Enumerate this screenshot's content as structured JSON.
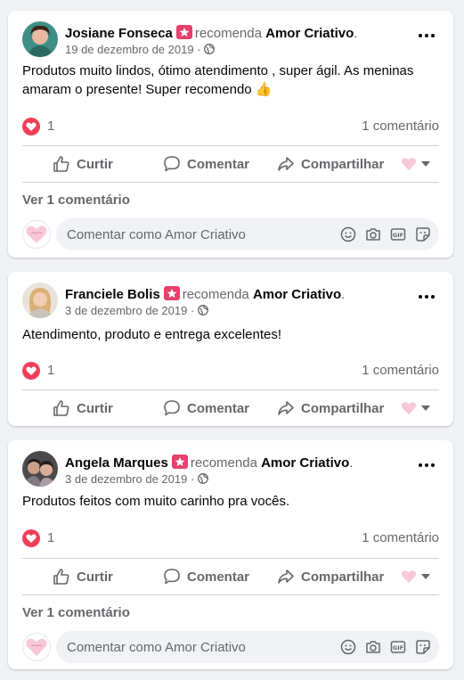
{
  "page_name": "Amor Criativo",
  "verb": "recomenda",
  "composer_placeholder": "Comentar como Amor Criativo",
  "actions": {
    "like": "Curtir",
    "comment": "Comentar",
    "share": "Compartilhar"
  },
  "colors": {
    "reaction_heart": "#f33e58",
    "recommend_badge": "#e5416c",
    "secondary_text": "#65676b"
  },
  "posts": [
    {
      "author": "Josiane Fonseca",
      "date": "19 de dezembro de 2019",
      "text": "Produtos muito lindos, ótimo atendimento , super ágil.  As meninas amaram o presente! Super recomendo 👍",
      "reaction_count": "1",
      "comment_count": "1 comentário",
      "view_comments": "Ver 1 comentário"
    },
    {
      "author": "Franciele Bolis",
      "date": "3 de dezembro de 2019",
      "text": "Atendimento, produto e entrega excelentes!",
      "reaction_count": "1",
      "comment_count": "1 comentário"
    },
    {
      "author": "Angela Marques",
      "date": "3 de dezembro de 2019",
      "text": "Produtos feitos com muito carinho pra vocês.",
      "reaction_count": "1",
      "comment_count": "1 comentário",
      "view_comments": "Ver 1 comentário"
    }
  ],
  "icons": [
    "recommend-badge-icon",
    "globe-icon",
    "more-options-icon",
    "heart-reaction-icon",
    "like-icon",
    "comment-icon",
    "share-icon",
    "emoji-icon",
    "camera-icon",
    "gif-icon",
    "sticker-icon"
  ]
}
